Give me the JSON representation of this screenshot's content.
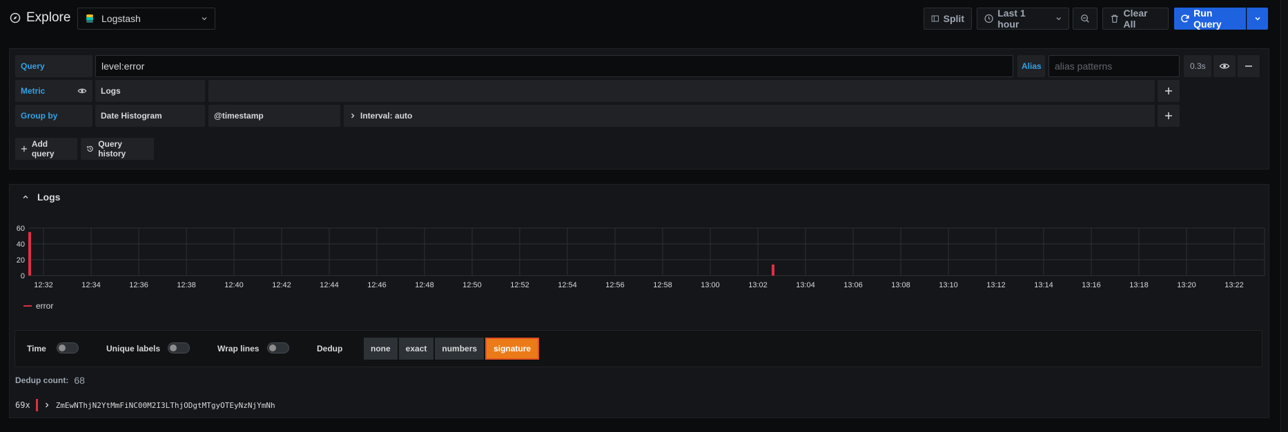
{
  "header": {
    "title": "Explore",
    "datasource": "Logstash",
    "split_label": "Split",
    "time_range": "Last 1 hour",
    "clear_label": "Clear All",
    "run_label": "Run Query"
  },
  "query": {
    "query_label": "Query",
    "query_value": "level:error",
    "alias_label": "Alias",
    "alias_placeholder": "alias patterns",
    "timing": "0.3s",
    "metric_label": "Metric",
    "metric_value": "Logs",
    "groupby_label": "Group by",
    "groupby_type": "Date Histogram",
    "groupby_field": "@timestamp",
    "interval": "Interval: auto",
    "add_query": "Add query",
    "query_history": "Query history"
  },
  "logs": {
    "title": "Logs",
    "options": {
      "time": "Time",
      "unique_labels": "Unique labels",
      "wrap_lines": "Wrap lines",
      "dedup": "Dedup",
      "dedup_modes": [
        "none",
        "exact",
        "numbers",
        "signature"
      ],
      "active_mode": "signature"
    },
    "dedup_count_label": "Dedup count:",
    "dedup_count": "68",
    "rows": [
      {
        "count": "69x",
        "message": "ZmEwNThjN2YtMmFiNC00M2I3LThjODgtMTgyOTEyNzNjYmNh",
        "level_color": "#e02f44"
      }
    ]
  },
  "chart_data": {
    "type": "bar",
    "y_ticks": [
      "60",
      "40",
      "20",
      "0"
    ],
    "ylim": [
      0,
      60
    ],
    "x_ticks": [
      "12:32",
      "12:34",
      "12:36",
      "12:38",
      "12:40",
      "12:42",
      "12:44",
      "12:46",
      "12:48",
      "12:50",
      "12:52",
      "12:54",
      "12:56",
      "12:58",
      "13:00",
      "13:02",
      "13:04",
      "13:06",
      "13:08",
      "13:10",
      "13:12",
      "13:14",
      "13:16",
      "13:18",
      "13:20",
      "13:22"
    ],
    "series": [
      {
        "name": "error",
        "color": "#e02f44",
        "points": [
          {
            "x": "12:32",
            "y": 55
          },
          {
            "x": "13:02",
            "y": 14
          }
        ]
      }
    ],
    "grid": true,
    "legend": "bottom-left"
  }
}
